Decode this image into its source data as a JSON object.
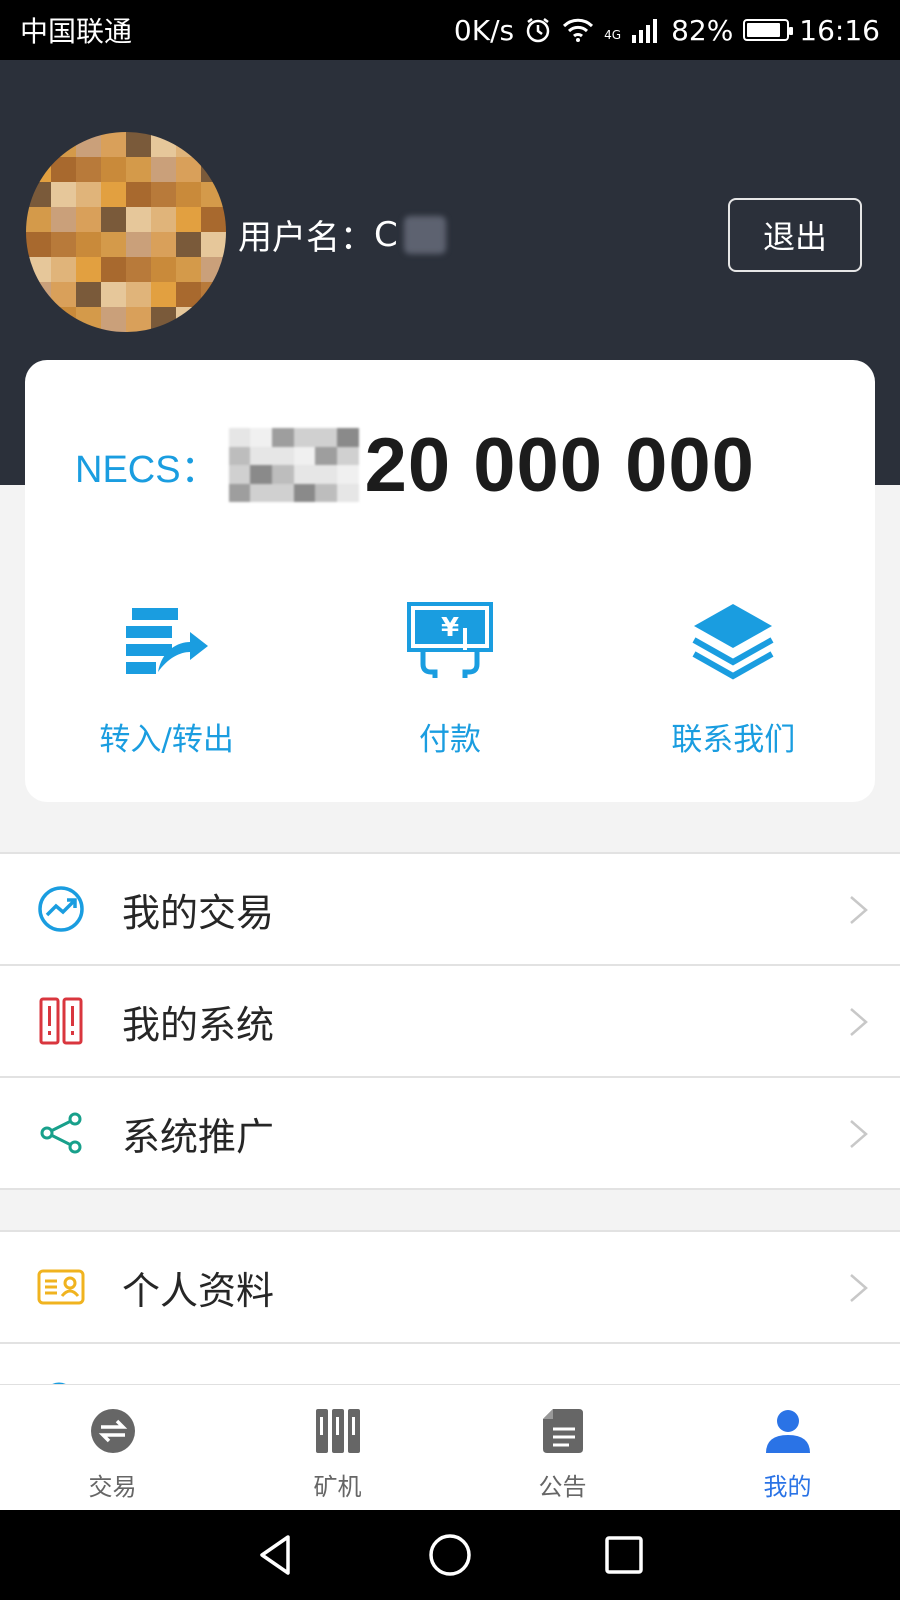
{
  "status_bar": {
    "carrier": "中国联通",
    "speed": "0K/s",
    "network": "4G",
    "battery": "82%",
    "time": "16:16"
  },
  "profile": {
    "username_label": "用户名：",
    "username_visible": "C",
    "logout_label": "退出"
  },
  "balance": {
    "label": "NECS：",
    "value": "20 000 000"
  },
  "actions": [
    {
      "label": "转入/转出",
      "icon": "transfer-icon"
    },
    {
      "label": "付款",
      "icon": "payment-icon"
    },
    {
      "label": "联系我们",
      "icon": "layers-icon"
    }
  ],
  "menu_group_1": [
    {
      "label": "我的交易",
      "icon": "trend-chart-icon",
      "color": "#1a9de0"
    },
    {
      "label": "我的系统",
      "icon": "server-icon",
      "color": "#d9363e"
    },
    {
      "label": "系统推广",
      "icon": "share-icon",
      "color": "#18a08b"
    }
  ],
  "menu_group_2": [
    {
      "label": "个人资料",
      "icon": "id-card-icon",
      "color": "#f0b31f"
    }
  ],
  "tabbar": [
    {
      "label": "交易",
      "icon": "exchange-icon",
      "active": false
    },
    {
      "label": "矿机",
      "icon": "miner-icon",
      "active": false
    },
    {
      "label": "公告",
      "icon": "notice-icon",
      "active": false
    },
    {
      "label": "我的",
      "icon": "user-icon",
      "active": true
    }
  ],
  "colors": {
    "accent": "#1a9de0",
    "header_bg": "#2b303a",
    "active_tab": "#2a73e6"
  }
}
